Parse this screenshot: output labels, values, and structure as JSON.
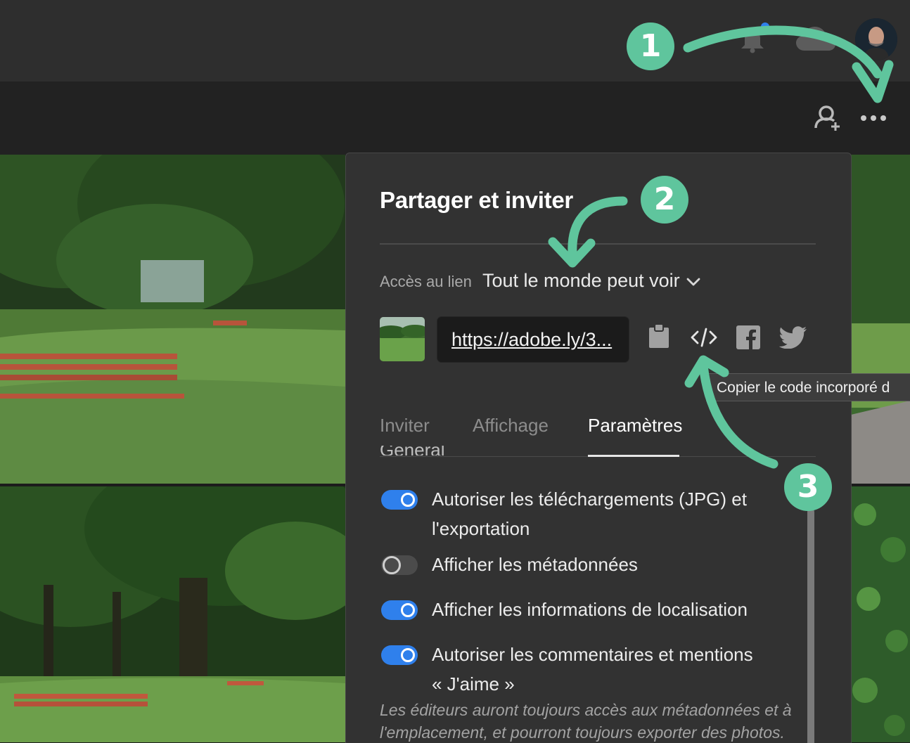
{
  "header": {
    "notifications_icon": "bell-icon",
    "cloud_icon": "cloud-icon",
    "avatar_icon": "user-avatar",
    "invite_icon": "add-user-icon",
    "more_icon": "more-dots-icon"
  },
  "callouts": [
    "1",
    "2",
    "3"
  ],
  "share_panel": {
    "title": "Partager et inviter",
    "link_access_label": "Accès au lien",
    "link_access_value": "Tout le monde peut voir",
    "url": "https://adobe.ly/3...",
    "actions": [
      "clipboard-icon",
      "embed-code-icon",
      "facebook-icon",
      "twitter-icon"
    ],
    "tooltip": "Copier le code incorporé d",
    "tabs": [
      "Inviter",
      "Affichage",
      "Paramètres"
    ],
    "active_tab": "Paramètres",
    "section_heading": "Général",
    "settings": [
      {
        "label": "Autoriser les téléchargements (JPG) et l'exportation",
        "enabled": true
      },
      {
        "label": "Afficher les métadonnées",
        "enabled": false
      },
      {
        "label": "Afficher les informations de localisation",
        "enabled": true
      },
      {
        "label": "Autoriser les commentaires et mentions « J'aime »",
        "enabled": true
      }
    ],
    "note": "Les éditeurs auront toujours accès aux métadonnées et à l'emplacement, et pourront toujours exporter des photos."
  },
  "colors": {
    "accent": "#2f80ec",
    "callout": "#5fc59d",
    "panel_bg": "#323232",
    "topbar_bg": "#2e2e2e"
  }
}
